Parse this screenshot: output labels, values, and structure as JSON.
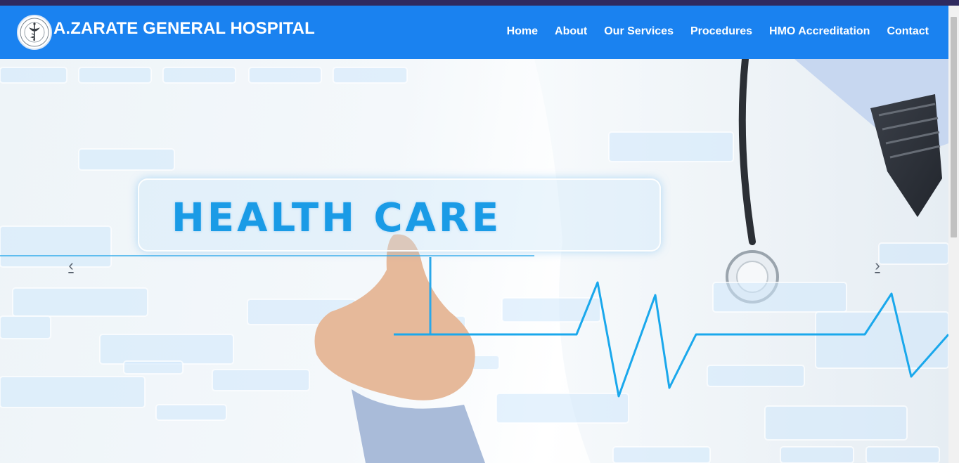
{
  "header": {
    "brand": "A.ZARATE GENERAL HOSPITAL",
    "nav": [
      "Home",
      "About",
      "Our Services",
      "Procedures",
      "HMO Accreditation",
      "Contact"
    ]
  },
  "hero": {
    "headline": "HEALTH CARE",
    "prev_glyph": "‹",
    "next_glyph": "›"
  },
  "colors": {
    "topbar": "#2f2a5f",
    "navbar": "#1a82f0",
    "headline": "#1a9be6"
  },
  "icons": [
    "hospital-logo-icon",
    "chevron-left-icon",
    "chevron-right-icon"
  ]
}
